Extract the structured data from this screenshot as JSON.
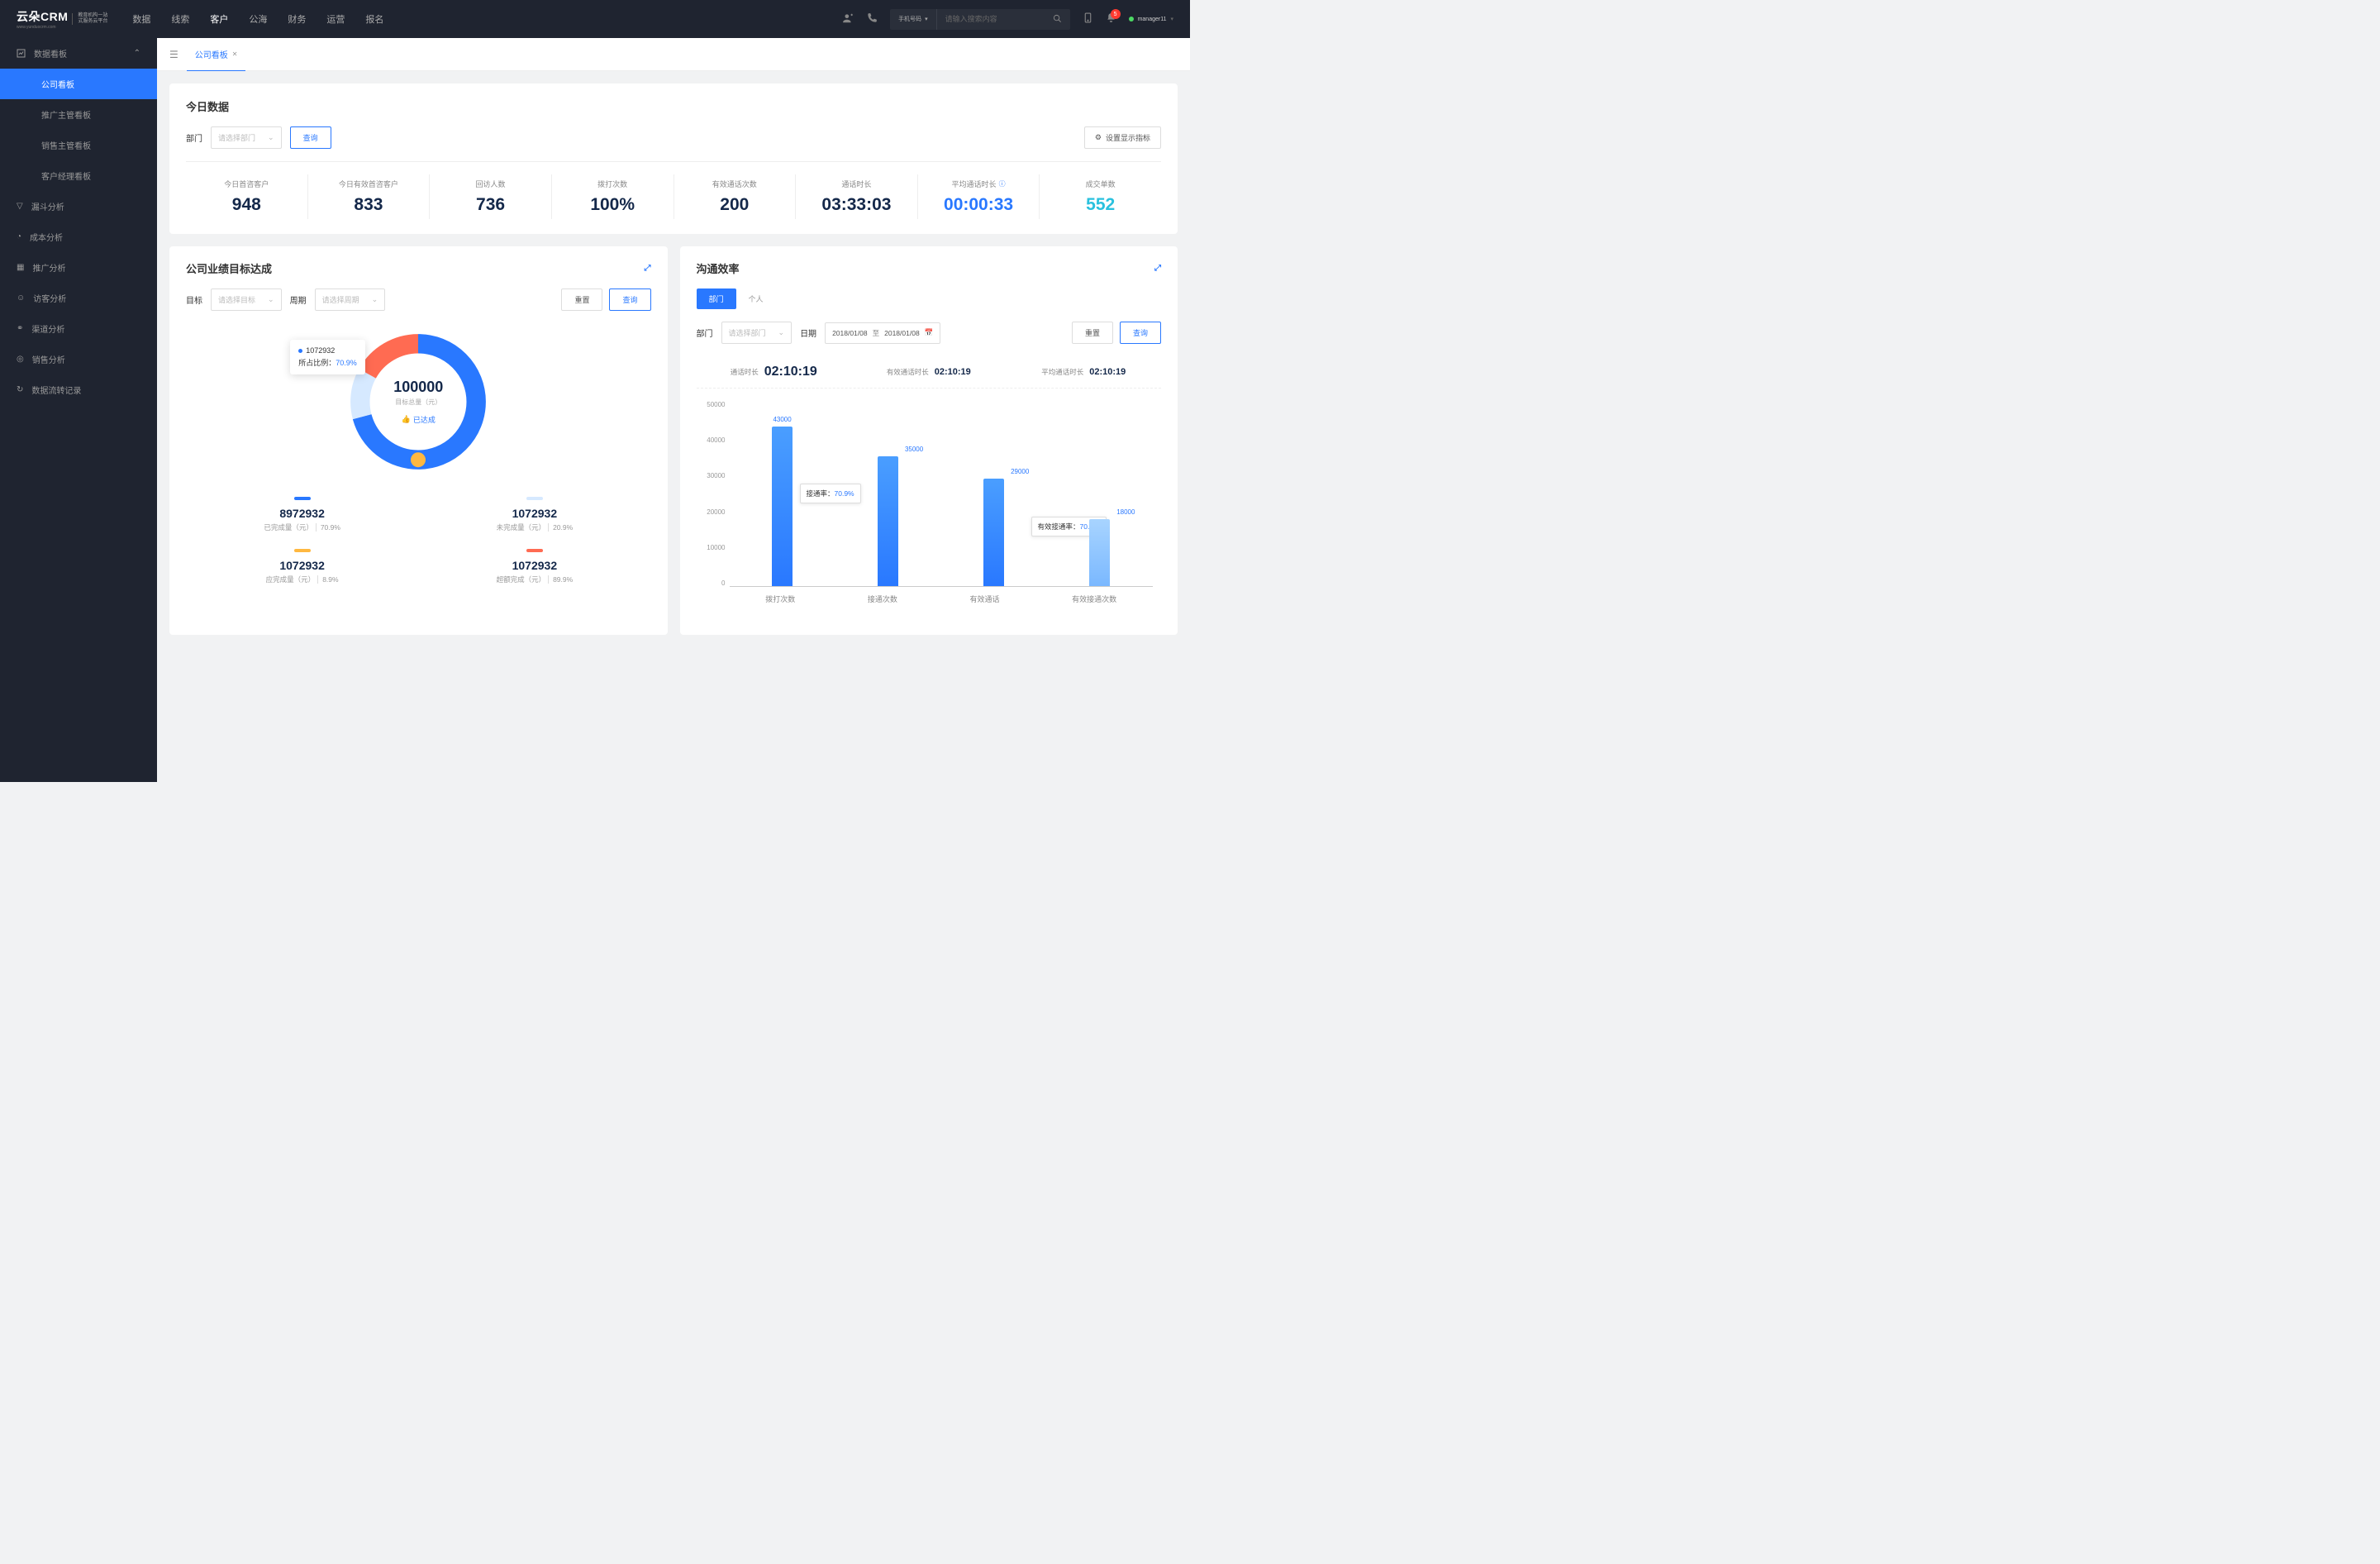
{
  "header": {
    "logo": "云朵CRM",
    "logo_url": "www.yunduocrm.com",
    "logo_sub1": "教育机构一站",
    "logo_sub2": "式服务云平台",
    "nav": [
      "数据",
      "线索",
      "客户",
      "公海",
      "财务",
      "运营",
      "报名"
    ],
    "nav_active": 2,
    "search_type": "手机号码",
    "search_placeholder": "请输入搜索内容",
    "badge": "5",
    "user": "manager11"
  },
  "sidebar": {
    "group": "数据看板",
    "items": [
      "公司看板",
      "推广主管看板",
      "销售主管看板",
      "客户经理看板"
    ],
    "active": 0,
    "menu": [
      "漏斗分析",
      "成本分析",
      "推广分析",
      "访客分析",
      "渠道分析",
      "销售分析",
      "数据流转记录"
    ]
  },
  "tabs": {
    "tab1": "公司看板"
  },
  "today": {
    "title": "今日数据",
    "dept_label": "部门",
    "dept_placeholder": "请选择部门",
    "query_btn": "查询",
    "settings_btn": "设置显示指标",
    "kpis": [
      {
        "label": "今日首咨客户",
        "value": "948",
        "color": ""
      },
      {
        "label": "今日有效首咨客户",
        "value": "833",
        "color": ""
      },
      {
        "label": "回访人数",
        "value": "736",
        "color": ""
      },
      {
        "label": "拨打次数",
        "value": "100%",
        "color": ""
      },
      {
        "label": "有效通话次数",
        "value": "200",
        "color": ""
      },
      {
        "label": "通话时长",
        "value": "03:33:03",
        "color": ""
      },
      {
        "label": "平均通话时长",
        "value": "00:00:33",
        "color": "blue",
        "help": true
      },
      {
        "label": "成交单数",
        "value": "552",
        "color": "cyan"
      }
    ]
  },
  "goal": {
    "title": "公司业绩目标达成",
    "target_label": "目标",
    "target_placeholder": "请选择目标",
    "period_label": "周期",
    "period_placeholder": "请选择周期",
    "reset_btn": "重置",
    "query_btn": "查询",
    "donut": {
      "center_num": "100000",
      "center_sub": "目标总量（元）",
      "badge": "已达成"
    },
    "tooltip": {
      "value": "1072932",
      "pct_label": "所占比例：",
      "pct": "70.9%"
    },
    "stats": [
      {
        "bar": "#2978ff",
        "value": "8972932",
        "label": "已完成量（元）",
        "pct": "70.9%"
      },
      {
        "bar": "#d6e9ff",
        "value": "1072932",
        "label": "未完成量（元）",
        "pct": "20.9%"
      },
      {
        "bar": "#ffb840",
        "value": "1072932",
        "label": "应完成量（元）",
        "pct": "8.9%"
      },
      {
        "bar": "#ff6b52",
        "value": "1072932",
        "label": "超额完成（元）",
        "pct": "89.9%"
      }
    ]
  },
  "efficiency": {
    "title": "沟通效率",
    "seg_dept": "部门",
    "seg_personal": "个人",
    "dept_label": "部门",
    "dept_placeholder": "请选择部门",
    "date_label": "日期",
    "date_from": "2018/01/08",
    "date_to": "2018/01/08",
    "date_sep": "至",
    "reset_btn": "重置",
    "query_btn": "查询",
    "times": [
      {
        "label": "通话时长",
        "value": "02:10:19",
        "big": true
      },
      {
        "label": "有效通话时长",
        "value": "02:10:19"
      },
      {
        "label": "平均通话时长",
        "value": "02:10:19"
      }
    ],
    "tip1": {
      "label": "接通率：",
      "pct": "70.9%"
    },
    "tip2": {
      "label": "有效接通率：",
      "pct": "70.9%"
    }
  },
  "chart_data": {
    "type": "bar",
    "ylim": [
      0,
      50000
    ],
    "yticks": [
      0,
      10000,
      20000,
      30000,
      40000,
      50000
    ],
    "categories": [
      "拨打次数",
      "接通次数",
      "有效通话",
      "有效接通次数"
    ],
    "series": [
      {
        "name": "main",
        "values": [
          43000,
          35000,
          29000,
          18000
        ],
        "labels": [
          "43000",
          "35000",
          "29000",
          "18000"
        ]
      }
    ],
    "annotations": [
      {
        "after_index": 0,
        "text": "接通率：70.9%"
      },
      {
        "after_index": 2,
        "text": "有效接通率：70.9%"
      }
    ]
  }
}
